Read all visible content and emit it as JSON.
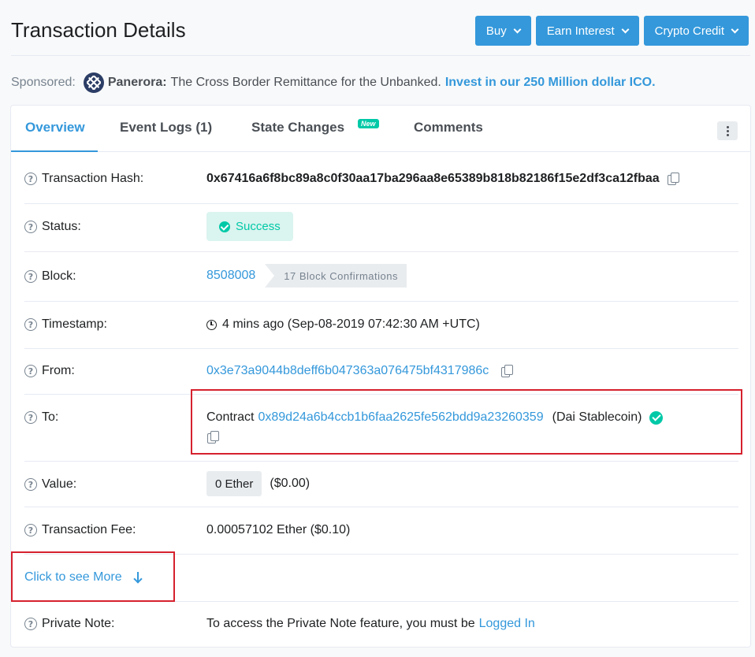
{
  "header": {
    "title": "Transaction Details",
    "buttons": [
      {
        "label": "Buy"
      },
      {
        "label": "Earn Interest"
      },
      {
        "label": "Crypto Credit"
      }
    ]
  },
  "sponsor": {
    "prefix": "Sponsored:",
    "brand": "Panerora:",
    "tagline": "The Cross Border Remittance for the Unbanked.",
    "cta": "Invest in our 250 Million dollar ICO."
  },
  "tabs": [
    {
      "label": "Overview",
      "active": true
    },
    {
      "label": "Event Logs (1)"
    },
    {
      "label": "State Changes",
      "badge": "New"
    },
    {
      "label": "Comments"
    }
  ],
  "details": {
    "tx_hash": {
      "label": "Transaction Hash:",
      "value": "0x67416a6f8bc89a8c0f30aa17ba296aa8e65389b818b82186f15e2df3ca12fbaa"
    },
    "status": {
      "label": "Status:",
      "value": "Success"
    },
    "block": {
      "label": "Block:",
      "value": "8508008",
      "confirmations": "17 Block Confirmations"
    },
    "timestamp": {
      "label": "Timestamp:",
      "value": "4 mins ago (Sep-08-2019 07:42:30 AM +UTC)"
    },
    "from": {
      "label": "From:",
      "value": "0x3e73a9044b8deff6b047363a076475bf4317986c"
    },
    "to": {
      "label": "To:",
      "prefix": "Contract",
      "address": "0x89d24a6b4ccb1b6faa2625fe562bdd9a23260359",
      "name": "(Dai Stablecoin)"
    },
    "value": {
      "label": "Value:",
      "amount": "0 Ether",
      "usd": "($0.00)"
    },
    "fee": {
      "label": "Transaction Fee:",
      "value": "0.00057102 Ether ($0.10)"
    },
    "more": {
      "label": "Click to see More"
    },
    "private_note": {
      "label": "Private Note:",
      "text": "To access the Private Note feature, you must be",
      "link": "Logged In"
    }
  },
  "colors": {
    "accent": "#3498db",
    "success": "#00c9a7",
    "highlight_box": "#d6212e"
  }
}
